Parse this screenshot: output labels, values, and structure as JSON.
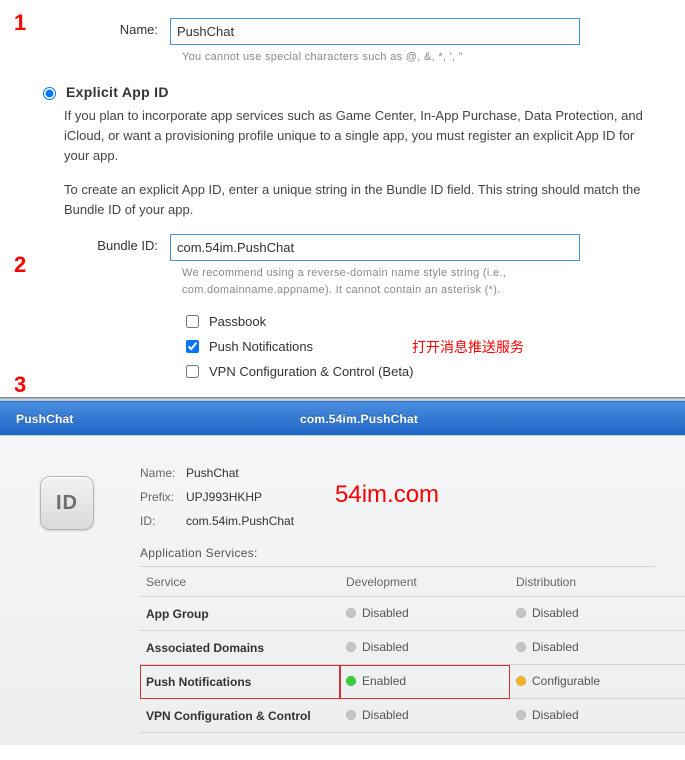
{
  "markers": {
    "one": "1",
    "two": "2",
    "three": "3"
  },
  "name_field": {
    "label": "Name:",
    "value": "PushChat",
    "hint": "You cannot use special characters such as @, &, *, ', \""
  },
  "explicit": {
    "title": "Explicit App ID",
    "para1": "If you plan to incorporate app services such as Game Center, In-App Purchase, Data Protection, and iCloud, or want a provisioning profile unique to a single app, you must register an explicit App ID for your app.",
    "para2": "To create an explicit App ID, enter a unique string in the Bundle ID field. This string should match the Bundle ID of your app."
  },
  "bundle_field": {
    "label": "Bundle ID:",
    "value": "com.54im.PushChat",
    "hint": "We recommend using a reverse-domain name style string (i.e., com.domainname.appname). It cannot contain an asterisk (*)."
  },
  "checks": {
    "passbook": "Passbook",
    "push": "Push Notifications",
    "vpn": "VPN Configuration & Control (Beta)",
    "annotation": "打开消息推送服务"
  },
  "tabbar": {
    "left": "PushChat",
    "right": "com.54im.PushChat"
  },
  "id_badge": "ID",
  "watermark": "54im.com",
  "meta": {
    "name_k": "Name:",
    "name_v": "PushChat",
    "prefix_k": "Prefix:",
    "prefix_v": "UPJ993HKHP",
    "id_k": "ID:",
    "id_v": "com.54im.PushChat"
  },
  "services": {
    "title": "Application Services:",
    "headers": {
      "service": "Service",
      "dev": "Development",
      "dist": "Distribution"
    },
    "rows": [
      {
        "svc": "App Group",
        "dev": "Disabled",
        "dist": "Disabled",
        "dev_dot": "grey",
        "dist_dot": "grey",
        "hl": false
      },
      {
        "svc": "Associated Domains",
        "dev": "Disabled",
        "dist": "Disabled",
        "dev_dot": "grey",
        "dist_dot": "grey",
        "hl": false
      },
      {
        "svc": "Push Notifications",
        "dev": "Enabled",
        "dist": "Configurable",
        "dev_dot": "green",
        "dist_dot": "orange",
        "hl": true
      },
      {
        "svc": "VPN Configuration & Control",
        "dev": "Disabled",
        "dist": "Disabled",
        "dev_dot": "grey",
        "dist_dot": "grey",
        "hl": false
      }
    ]
  }
}
